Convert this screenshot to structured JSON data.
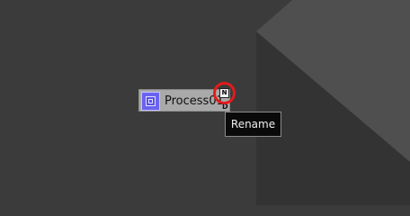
{
  "node": {
    "label": "Process01",
    "icon": "process-node-icon",
    "rename_button_label": "N",
    "port_label": "D",
    "background": "#a9a9a9",
    "icon_color": "#6a63f0"
  },
  "tooltip": {
    "text": "Rename"
  },
  "highlight": {
    "color": "#e31b1b"
  },
  "colors": {
    "canvas": "#3b3b3b",
    "panel_light": "#4f4f4f",
    "panel_dark": "#333333"
  }
}
